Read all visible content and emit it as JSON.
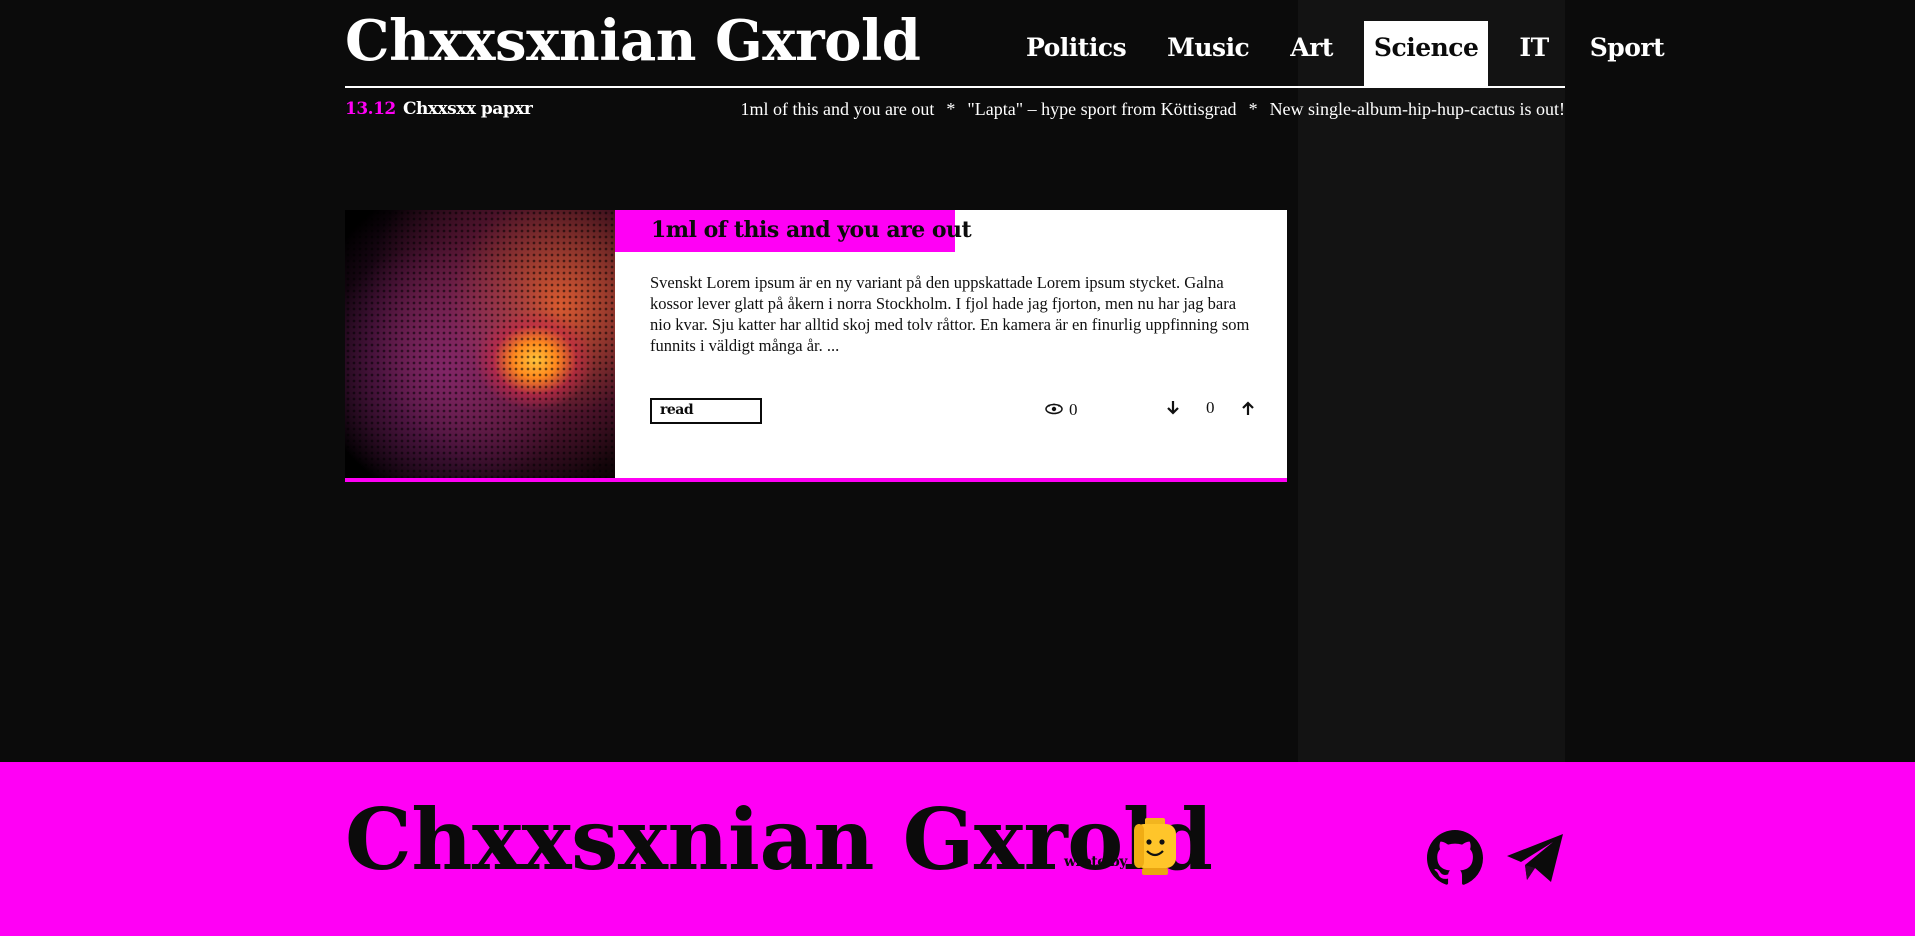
{
  "header": {
    "brand": "Chxxsxnian Gxrold",
    "nav": [
      {
        "label": "Politics",
        "active": false
      },
      {
        "label": "Music",
        "active": false
      },
      {
        "label": "Art",
        "active": false
      },
      {
        "label": "Science",
        "active": true
      },
      {
        "label": "IT",
        "active": false
      },
      {
        "label": "Sport",
        "active": false
      }
    ]
  },
  "ticker": {
    "date": "13.12",
    "paper_label": "Chxxsxx papxr",
    "items": [
      "1ml of this and you are out",
      "\"Lapta\" – hype sport from Köttisgrad",
      "New single-album-hip-hup-cactus is out!"
    ],
    "separator": "*"
  },
  "article": {
    "title": "1ml of this and you are out",
    "excerpt": "Svenskt Lorem ipsum är en ny variant på den uppskattade Lorem ipsum stycket. Galna kossor lever glatt på åkern i norra Stockholm. I fjol hade jag fjorton, men nu har jag bara nio kvar. Sju katter har alltid skoj med tolv råttor. En kamera är en finurlig uppfinning som funnits i väldigt många år. ...",
    "read_label": "read",
    "views": "0",
    "score": "0",
    "icons": {
      "views": "eye-icon",
      "down": "arrow-down-icon",
      "up": "arrow-up-icon"
    }
  },
  "footer": {
    "brand": "Chxxsxnian Gxrold",
    "wrote_by": "wrote by",
    "icons": [
      "github-icon",
      "telegram-icon"
    ]
  },
  "colors": {
    "accent": "#ff00f5",
    "background": "#0b0b0b",
    "side": "#131313",
    "text_light": "#ffffff"
  }
}
